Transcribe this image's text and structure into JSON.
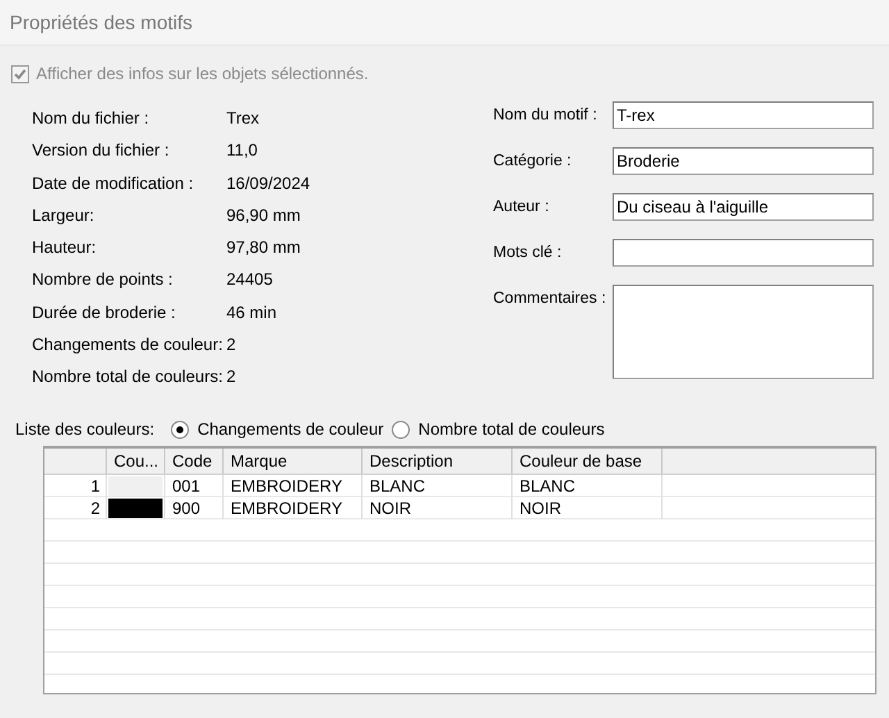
{
  "window": {
    "title": "Propriétés des motifs"
  },
  "show_info": {
    "label": "Afficher des infos sur les objets sélectionnés.",
    "checked": true,
    "disabled": true
  },
  "file_info": [
    {
      "label": "Nom du fichier :",
      "value": "Trex"
    },
    {
      "label": "Version du fichier :",
      "value": "11,0"
    },
    {
      "label": "Date de modification :",
      "value": "16/09/2024"
    },
    {
      "label": "Largeur:",
      "value": "96,90 mm"
    },
    {
      "label": "Hauteur:",
      "value": "97,80 mm"
    },
    {
      "label": "Nombre de points :",
      "value": "24405"
    },
    {
      "label": "Durée de broderie :",
      "value": "46 min"
    },
    {
      "label": "Changements de couleur:",
      "value": "2"
    },
    {
      "label": "Nombre total de couleurs:",
      "value": "2"
    }
  ],
  "fields": [
    {
      "label": "Nom du motif :",
      "value": "T-rex",
      "kind": "line"
    },
    {
      "label": "Catégorie :",
      "value": "Broderie",
      "kind": "line"
    },
    {
      "label": "Auteur :",
      "value": "Du ciseau à l'aiguille",
      "kind": "line"
    },
    {
      "label": "Mots clé :",
      "kind": "line"
    },
    {
      "label": "Commentaires :",
      "kind": "multiline"
    }
  ],
  "color_list": {
    "label": "Liste des couleurs:",
    "options": [
      {
        "label": "Changements de couleur",
        "selected": true
      },
      {
        "label": "Nombre total de couleurs",
        "selected": false
      }
    ]
  },
  "table": {
    "columns": [
      "Cou...",
      "Code",
      "Marque",
      "Description",
      "Couleur de base"
    ],
    "rows": [
      {
        "index": "1",
        "color": "#f0f0f0",
        "code": "001",
        "brand": "EMBROIDERY",
        "description": "BLANC",
        "base_color": "BLANC"
      },
      {
        "index": "2",
        "color": "#000000",
        "code": "900",
        "brand": "EMBROIDERY",
        "description": "NOIR",
        "base_color": "NOIR"
      }
    ]
  }
}
